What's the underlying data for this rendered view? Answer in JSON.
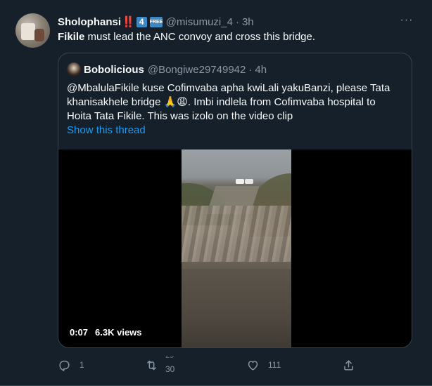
{
  "tweet": {
    "author_name": "Sholophansi",
    "author_emoji_1": "‼️",
    "badge_1": "4",
    "badge_2": "FREE",
    "handle": "@misumuzi_4",
    "separator": "·",
    "time": "3h",
    "text_bold": "Fikile",
    "text_rest": " must lead the ANC convoy and cross this bridge.",
    "more_label": "···"
  },
  "quote": {
    "author_name": "Bobolicious",
    "handle": "@Bongiwe29749942",
    "separator": "·",
    "time": "4h",
    "text": "@MbalulaFikile kuse Cofimvaba apha kwiLali yakuBanzi, please Tata khanisakhele bridge 🙏😩. Imbi indlela from Cofimvaba hospital to Hoita Tata Fikile. This was izolo on the video clip",
    "show_thread": "Show this thread",
    "video": {
      "timestamp": "0:07",
      "views": "6.3K views"
    }
  },
  "actions": {
    "reply_count": "1",
    "retweet_count_old": "29",
    "retweet_count": "30",
    "like_count": "111"
  },
  "colors": {
    "background": "#15202b",
    "text": "#f7f9f9",
    "muted": "#8b98a5",
    "link": "#1d9bf0",
    "border": "#38444d"
  }
}
